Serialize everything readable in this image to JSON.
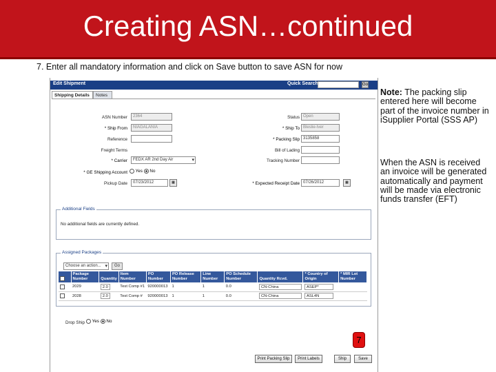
{
  "slide": {
    "title": "Creating ASN…continued",
    "instruction": "7. Enter all mandatory information and click on Save button to save ASN for now"
  },
  "app": {
    "header_title": "Edit Shipment",
    "quick_search_label": "Quick Search",
    "quick_search_go": "Go",
    "tabs": [
      "Shipping Details",
      "Notes"
    ],
    "fields": {
      "asn_number": {
        "label": "ASN Number",
        "value": "2364"
      },
      "status": {
        "label": "Status",
        "value": "Open"
      },
      "ship_from": {
        "label": "* Ship From",
        "value": "NIAGALANIA"
      },
      "ship_to": {
        "label": "* Ship To",
        "value": "Bleslie-Iver"
      },
      "reference": {
        "label": "Reference",
        "value": ""
      },
      "packing_slip": {
        "label": "* Packing Slip",
        "value": "3135858"
      },
      "freight_terms": {
        "label": "Freight Terms",
        "value": ""
      },
      "bill_of_lading": {
        "label": "Bill of Lading",
        "value": ""
      },
      "carrier": {
        "label": "* Carrier",
        "value": "FEDX AR 2nd Day Air"
      },
      "tracking_number": {
        "label": "Tracking Number",
        "value": ""
      },
      "ge_shipping_account": {
        "label": "* GE Shipping Account",
        "options": [
          "Yes",
          "No"
        ],
        "selected": "No"
      },
      "pickup_date": {
        "label": "Pickup Date",
        "value": "07/23/2012"
      },
      "expected_receipt_date": {
        "label": "* Expected Receipt Date",
        "value": "07/26/2012"
      }
    },
    "additional_fields": {
      "title": "Additional Fields",
      "message": "No additional fields are currently defined."
    },
    "assigned_packages": {
      "title": "Assigned Packages",
      "action_select": "Choose an action...",
      "action_go": "Go",
      "columns": [
        "Package Number",
        "Quantity",
        "Item Number",
        "PO Number",
        "PO Release Number",
        "Line Number",
        "PO Schedule Number",
        "Quantity Rcvd.",
        "* Country of Origin",
        "* MIR Lot Number"
      ],
      "rows": [
        [
          "2029",
          "2.0",
          "Test Comp #1",
          "920000013",
          "1",
          "1",
          "0.0",
          "CN-China",
          "ASEP*"
        ],
        [
          "2028",
          "2.0",
          "Test Comp #",
          "920000013",
          "1",
          "1",
          "0.0",
          "CN-China",
          "ASL4N"
        ]
      ]
    },
    "drop_ship": {
      "label": "Drop Ship",
      "options": [
        "Yes",
        "No"
      ],
      "selected": "No"
    },
    "buttons": [
      "Print Packing Slip",
      "Print Labels",
      "Ship",
      "Save"
    ],
    "step_marker": "7"
  },
  "notes": {
    "note_label": "Note:",
    "note_text": " The packing slip entered here will become part of the invoice number in iSupplier Portal (SSS AP)",
    "asn_text": "When the ASN is received an invoice will be generated automatically and payment will be made via electronic funds transfer (EFT)"
  },
  "colors": {
    "banner": "#c1141b",
    "app_header": "#1a3f86",
    "table_header": "#34589c",
    "marker": "#e01010"
  }
}
